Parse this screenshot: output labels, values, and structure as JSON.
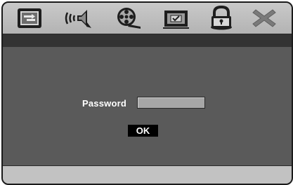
{
  "toolbar": {
    "icons": [
      {
        "name": "picture-settings-icon"
      },
      {
        "name": "audio-settings-icon"
      },
      {
        "name": "video-reel-icon"
      },
      {
        "name": "preferences-check-icon"
      },
      {
        "name": "lock-icon",
        "selected": true
      },
      {
        "name": "close-icon"
      }
    ]
  },
  "dialog": {
    "password_label": "Password",
    "password_value": "",
    "ok_label": "OK"
  },
  "colors": {
    "toolbar_bg": "#bdbdbd",
    "content_bg": "#5a5a5a",
    "strip_bg": "#333333",
    "field_bg": "#a7a7a7",
    "button_bg": "#000000",
    "footer_bg": "#c2c2c2"
  }
}
